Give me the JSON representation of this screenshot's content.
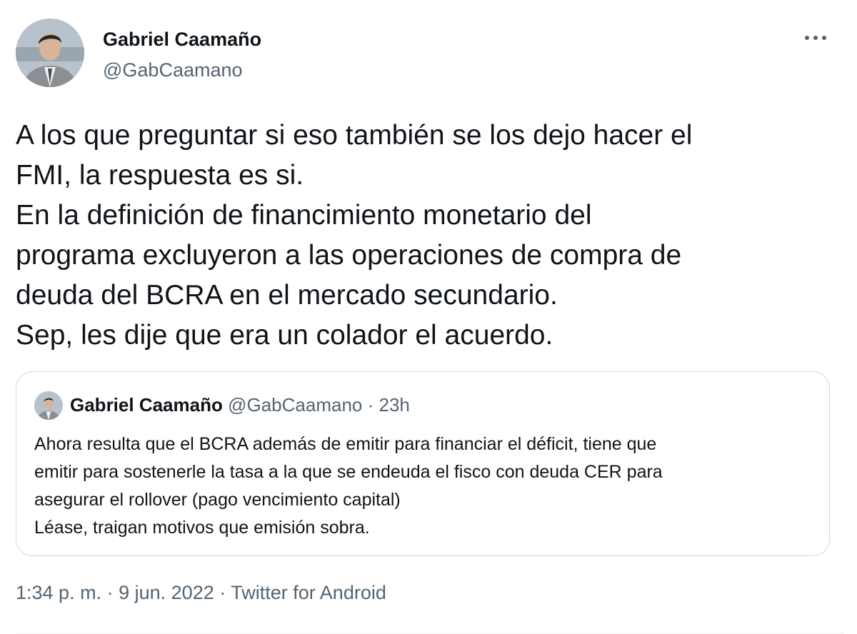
{
  "author": {
    "name": "Gabriel Caamaño",
    "handle": "@GabCaamano",
    "avatar": "profile-photo"
  },
  "more_icon": "more-horizontal-icon",
  "tweet": {
    "lines": [
      "A los que preguntar si eso también se los dejo hacer el",
      "FMI, la respuesta es si.",
      "En la definición de financimiento monetario del",
      "programa excluyeron a las operaciones de compra de",
      "deuda del BCRA en el mercado secundario.",
      "Sep, les dije que era un colador el acuerdo."
    ]
  },
  "quote": {
    "name": "Gabriel Caamaño",
    "handle": "@GabCaamano",
    "separator": "·",
    "time": "23h",
    "lines": [
      "Ahora resulta que el BCRA además de emitir para financiar el déficit, tiene que",
      "emitir para sostenerle la tasa a la que se endeuda el fisco con deuda CER para",
      "asegurar el rollover (pago vencimiento capital)",
      "Léase, traigan motivos que emisión sobra."
    ]
  },
  "meta": {
    "time": "1:34 p. m.",
    "separator": "·",
    "date": "9 jun. 2022",
    "source": "Twitter for Android"
  },
  "colors": {
    "text": "#0f1419",
    "secondary": "#536471",
    "border": "#cfd9de"
  }
}
